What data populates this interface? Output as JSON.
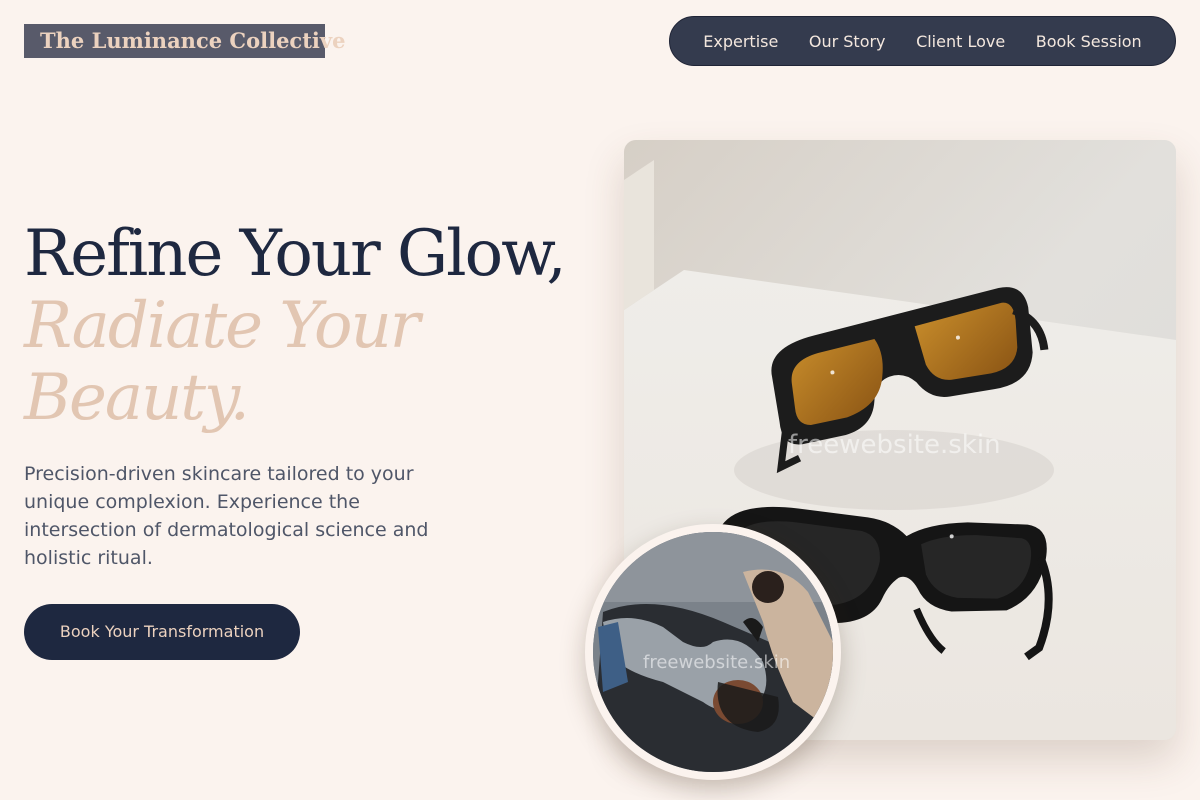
{
  "brand": {
    "name": "The Luminance Collective"
  },
  "nav": {
    "items": [
      {
        "label": "Expertise"
      },
      {
        "label": "Our Story"
      },
      {
        "label": "Client Love"
      },
      {
        "label": "Book Session"
      }
    ]
  },
  "hero": {
    "title_line1": "Refine Your Glow,",
    "title_line2": "Radiate Your",
    "title_line3": "Beauty.",
    "description": "Precision-driven skincare tailored to your unique complexion. Experience the intersection of dermatological science and holistic ritual.",
    "cta_label": "Book Your Transformation"
  },
  "images": {
    "main_watermark": "freewebsite.skin",
    "circle_watermark": "freewebsite.skin"
  },
  "colors": {
    "background": "#fbf3ee",
    "navy": "#1e2840",
    "accent_beige": "#e2c6b2",
    "nav_bg": "#343b4e"
  }
}
